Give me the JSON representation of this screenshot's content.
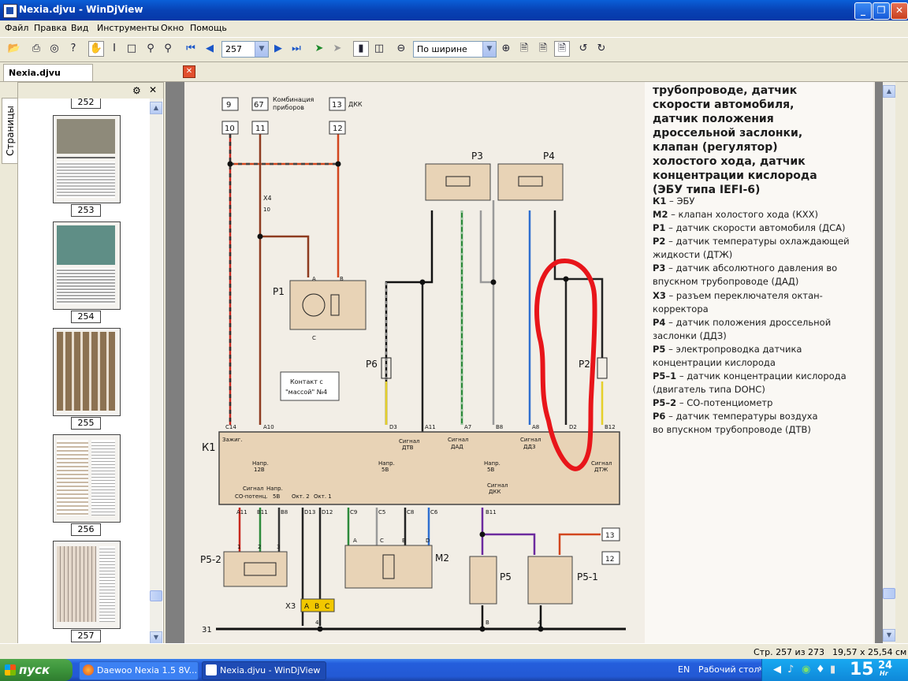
{
  "window": {
    "title": "Nexia.djvu - WinDjView",
    "minimize": "_",
    "maximize": "❐",
    "close": "✕"
  },
  "menu": [
    "Файл",
    "Правка",
    "Вид",
    "Инструменты",
    "Окно",
    "Помощь"
  ],
  "toolbar": {
    "page_number": "257",
    "zoom": "По ширине"
  },
  "tab": {
    "label": "Nexia.djvu",
    "close": "✕"
  },
  "sidebar": {
    "vertical_tab": "Страницы",
    "top_partial_label": "252",
    "page_labels": [
      "253",
      "254",
      "255",
      "256",
      "257"
    ]
  },
  "document": {
    "heading_lines": [
      "трубопроводе, датчик",
      "скорости автомобиля,",
      "датчик положения",
      "дроссельной заслонки,",
      "клапан (регулятор)",
      "холостого хода, датчик",
      "концентрации кислорода",
      "(ЭБУ типа IEFI-6)"
    ],
    "legend": [
      {
        "key": "К1",
        "text": " – ЭБУ"
      },
      {
        "key": "М2",
        "text": " – клапан холостого хода (КХХ)"
      },
      {
        "key": "Р1",
        "text": " – датчик скорости автомобиля (ДСА)"
      },
      {
        "key": "Р2",
        "text": " – датчик температуры охлаждающей"
      },
      {
        "key": "",
        "text": "жидкости (ДТЖ)"
      },
      {
        "key": "Р3",
        "text": " – датчик абсолютного давления во"
      },
      {
        "key": "",
        "text": "впускном трубопроводе (ДАД)"
      },
      {
        "key": "Х3",
        "text": " – разъем переключателя октан-"
      },
      {
        "key": "",
        "text": "корректора"
      },
      {
        "key": "Р4",
        "text": " – датчик положения дроссельной"
      },
      {
        "key": "",
        "text": "заслонки (ДДЗ)"
      },
      {
        "key": "Р5",
        "text": " – электропроводка датчика"
      },
      {
        "key": "",
        "text": "концентрации кислорода"
      },
      {
        "key": "Р5–1",
        "text": " – датчик концентрации кислорода"
      },
      {
        "key": "",
        "text": "(двигатель типа DOHC)"
      },
      {
        "key": "Р5–2",
        "text": " – СО-потенциометр"
      },
      {
        "key": "Р6",
        "text": " – датчик температуры воздуха"
      },
      {
        "key": "",
        "text": "во впускном трубопроводе (ДТВ)"
      }
    ],
    "diagram": {
      "top_boxes": [
        "9",
        "67",
        "13"
      ],
      "top_boxes2": [
        "10",
        "11",
        "12"
      ],
      "label_kombinacia": "Комбинация",
      "label_priborov": "приборов",
      "label_dkk": "ДКК",
      "label_x4": "Х4",
      "label_x4_pin": "10",
      "p1": "Р1",
      "p1_pin_a": "A",
      "p1_pin_b": "B",
      "p1_pin_c": "C",
      "kontakt1": "Контакт с",
      "kontakt2": "\"массой\" №4",
      "p3": "Р3",
      "p4": "Р4",
      "p6": "Р6",
      "p2": "Р2",
      "pin_a": "A",
      "pin_b": "B",
      "pin_c": "C",
      "k1": "К1",
      "ecu_pins_top": [
        "C14",
        "A10",
        "D3",
        "A11",
        "A7",
        "B8",
        "A8",
        "D2",
        "B12"
      ],
      "ecu_labels": {
        "zazhig": "Зажиг.",
        "napr12": "Напр.",
        "napr12b": "12В",
        "signal_dtv": "Сигнал",
        "signal_dtv2": "ДТВ",
        "signal_dad": "Сигнал",
        "signal_dad2": "ДАД",
        "signal_ddz": "Сигнал",
        "signal_ddz2": "ДДЗ",
        "signal_dtzh": "Сигнал",
        "signal_dtzh2": "ДТЖ",
        "napr5a": "Напр.",
        "napr5a2": "5В",
        "napr5b": "Напр.",
        "napr5b2": "5В",
        "signal_dkk": "Сигнал",
        "signal_dkk2": "ДКК",
        "signal_co": "Сигнал",
        "signal_co2": "СО-потенц.",
        "napr5c": "Напр.",
        "napr5c2": "5В",
        "okt2": "Окт. 2",
        "okt1": "Окт. 1"
      },
      "ecu_pins_bottom": [
        "A11",
        "B11",
        "B8",
        "D13",
        "D12",
        "C9",
        "C5",
        "C8",
        "C6",
        "B11"
      ],
      "p52": "Р5-2",
      "p52_pins": [
        "1",
        "2",
        "3"
      ],
      "m2": "М2",
      "m2_pins": [
        "A",
        "C",
        "B",
        "D"
      ],
      "x3": "Х3",
      "x3_pins": [
        "A",
        "B",
        "C"
      ],
      "p5": "Р5",
      "p51": "Р5-1",
      "box13": "13",
      "box12": "12",
      "ground": "31",
      "ground_pin4a": "4",
      "ground_pinb": "B",
      "ground_pin4b": "4"
    }
  },
  "status": {
    "page_info": "Стр. 257 из 273",
    "page_size": "19,57 x 25,54 см"
  },
  "taskbar": {
    "start": "пуск",
    "items": [
      "Daewoo Nexia 1.5 8V...",
      "Nexia.djvu - WinDjView"
    ],
    "lang": "EN",
    "desktop": "Рабочий стол",
    "clock_h": "15",
    "clock_m": "24",
    "clock_suffix": "Hr"
  }
}
